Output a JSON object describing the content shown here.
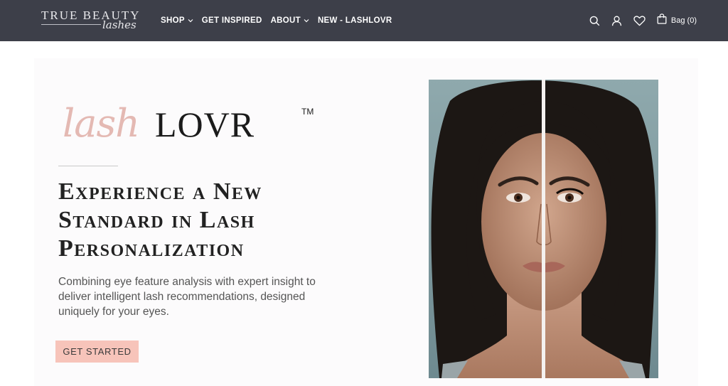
{
  "header": {
    "logo": {
      "line1": "TRUE BEAUTY",
      "line2": "lashes"
    },
    "nav": [
      {
        "label": "SHOP",
        "has_dropdown": true
      },
      {
        "label": "GET INSPIRED",
        "has_dropdown": false
      },
      {
        "label": "ABOUT",
        "has_dropdown": true
      },
      {
        "label": "NEW - LASHLOVR",
        "has_dropdown": false
      }
    ],
    "icons": [
      "search-icon",
      "account-icon",
      "heart-icon",
      "bag-icon"
    ],
    "bag_label": "Bag (0)"
  },
  "hero": {
    "brand_script": "lash",
    "brand_caps": "LOVR",
    "brand_tm": "TM",
    "headline_lines": [
      "Experience a New",
      "Standard in Lash",
      "Personalization"
    ],
    "description_lines": [
      "Combining eye feature analysis with expert insight to",
      "deliver intelligent lash recommendations, designed",
      "uniquely for your eyes."
    ],
    "cta_label": "GET STARTED",
    "image_subject": "split before/after face portrait"
  },
  "colors": {
    "header_bg": "#3d3f49",
    "accent_pink": "#f7c4ba",
    "script_pink": "#e4b9b3",
    "hero_bg": "#fcfbfc"
  }
}
